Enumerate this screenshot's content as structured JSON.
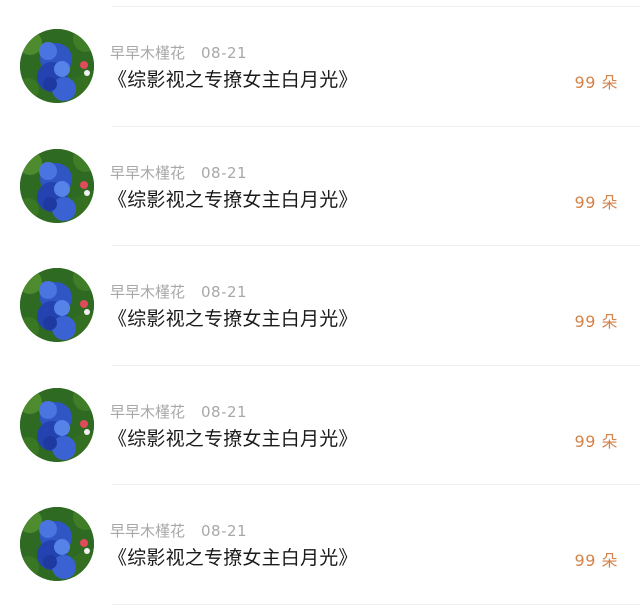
{
  "items": [
    {
      "avatar": "blue-hydrangea-avatar",
      "author": "早早木槿花",
      "date": "08-21",
      "title": "《综影视之专撩女主白月光》",
      "count": "99 朵"
    },
    {
      "avatar": "blue-hydrangea-avatar",
      "author": "早早木槿花",
      "date": "08-21",
      "title": "《综影视之专撩女主白月光》",
      "count": "99 朵"
    },
    {
      "avatar": "blue-hydrangea-avatar",
      "author": "早早木槿花",
      "date": "08-21",
      "title": "《综影视之专撩女主白月光》",
      "count": "99 朵"
    },
    {
      "avatar": "blue-hydrangea-avatar",
      "author": "早早木槿花",
      "date": "08-21",
      "title": "《综影视之专撩女主白月光》",
      "count": "99 朵"
    },
    {
      "avatar": "blue-hydrangea-avatar",
      "author": "早早木槿花",
      "date": "08-21",
      "title": "《综影视之专撩女主白月光》",
      "count": "99 朵"
    }
  ],
  "colors": {
    "count": "#d4834b",
    "meta": "#a8a8a8",
    "title": "#1a1a1a",
    "divider": "#efefef"
  }
}
